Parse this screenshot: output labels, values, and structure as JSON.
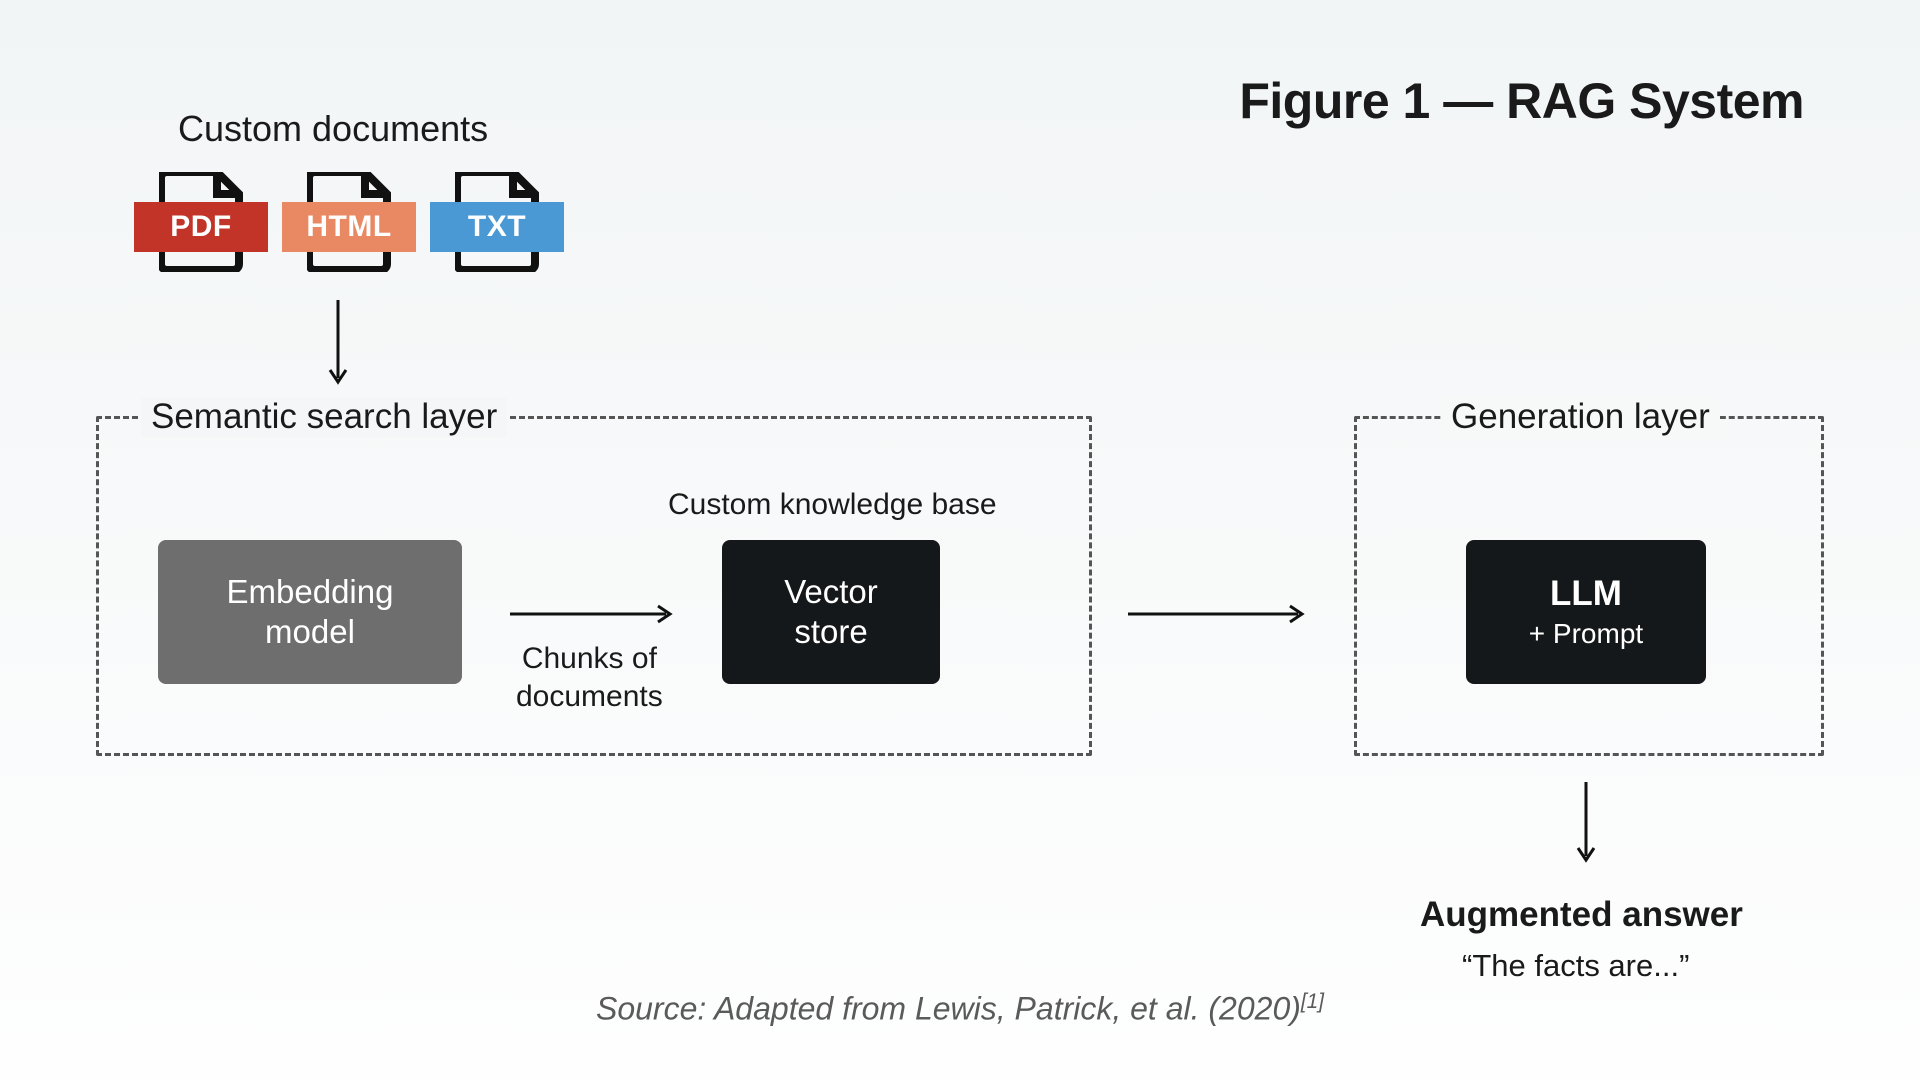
{
  "title": "Figure 1 — RAG System",
  "documents": {
    "header": "Custom documents",
    "types": [
      "PDF",
      "HTML",
      "TXT"
    ]
  },
  "layers": {
    "semantic": "Semantic search layer",
    "generation": "Generation layer"
  },
  "blocks": {
    "embedding_l1": "Embedding",
    "embedding_l2": "model",
    "vector_l1": "Vector",
    "vector_l2": "store",
    "llm_title": "LLM",
    "llm_sub": "+ Prompt"
  },
  "labels": {
    "knowledge_base": "Custom knowledge base",
    "chunks_l1": "Chunks of",
    "chunks_l2": "documents",
    "augmented_title": "Augmented answer",
    "augmented_sub": "“The facts are...”"
  },
  "source": {
    "prefix": "Source: Adapted from Lewis, Patrick, et al. (2020)",
    "cite": "[1]"
  },
  "colors": {
    "pdf": "#c23428",
    "html": "#e98964",
    "txt": "#4a98d4",
    "dark": "#15181a",
    "gray": "#6e6e6e"
  }
}
